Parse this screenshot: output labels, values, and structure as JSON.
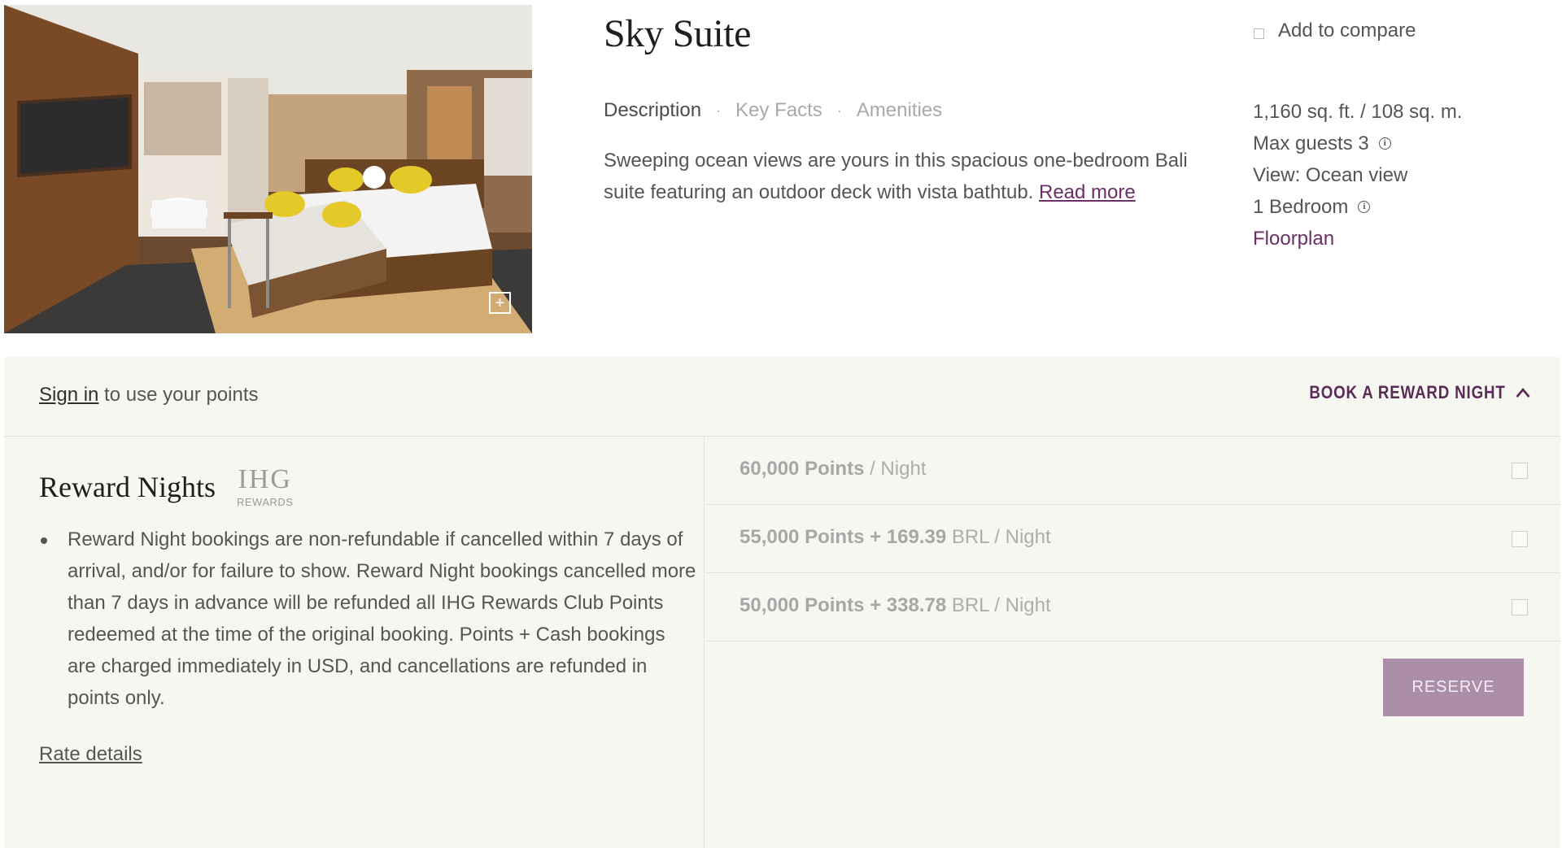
{
  "room": {
    "title": "Sky Suite",
    "compare_label": "Add to compare",
    "tabs": [
      "Description",
      "Key Facts",
      "Amenities"
    ],
    "description": "Sweeping ocean views are yours in this spacious one-bedroom Bali suite featuring an outdoor deck with vista bathtub.",
    "read_more": "Read more",
    "facts": {
      "size": "1,160 sq. ft. / 108 sq. m.",
      "max_guests": "Max guests 3",
      "view": "View: Ocean view",
      "bedrooms": "1 Bedroom",
      "floorplan": "Floorplan"
    },
    "icons": {
      "expand": "expand-image-icon",
      "info": "info-icon"
    }
  },
  "reward": {
    "signin_link": "Sign in",
    "signin_suffix": " to use your points",
    "book_toggle": "BOOK A REWARD NIGHT",
    "title": "Reward Nights",
    "logo": {
      "big": "IHG",
      "small": "REWARDS"
    },
    "policy": "Reward Night bookings are non-refundable if cancelled within 7 days of arrival, and/or for failure to show. Reward Night bookings cancelled more than 7 days in advance will be refunded all IHG Rewards Club Points redeemed at the time of the original booking. Points + Cash bookings are charged immediately in USD, and cancellations are refunded in points only.",
    "rate_details": "Rate details",
    "options": [
      {
        "bold": "60,000 Points",
        "rest": " / Night"
      },
      {
        "bold": "55,000 Points + 169.39",
        "rest": " BRL / Night"
      },
      {
        "bold": "50,000 Points + 338.78",
        "rest": " BRL / Night"
      }
    ],
    "reserve": "RESERVE"
  },
  "colors": {
    "accent": "#6a2f65",
    "reserve_bg": "#ab8ea8",
    "panel_bg": "#f7f7f2"
  }
}
